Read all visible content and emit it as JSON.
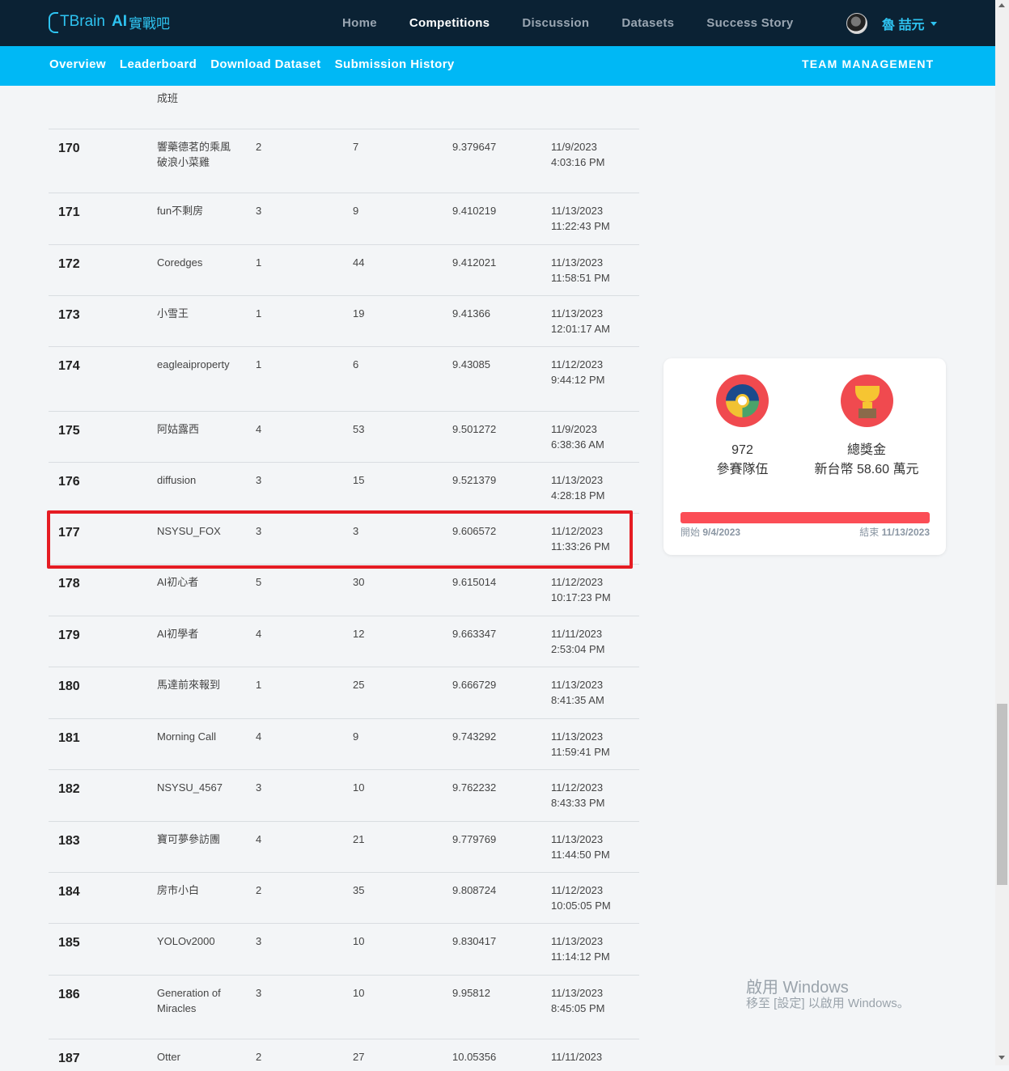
{
  "header": {
    "logo_text": "TBrain",
    "logo_ai": "AI",
    "logo_cn": "實戰吧",
    "nav": [
      "Home",
      "Competitions",
      "Discussion",
      "Datasets",
      "Success Story"
    ],
    "active_nav": "Competitions",
    "user_name": "魯 喆元"
  },
  "subnav": {
    "links": [
      "Overview",
      "Leaderboard",
      "Download Dataset",
      "Submission History"
    ],
    "team_management": "TEAM MANAGEMENT"
  },
  "leaderboard": {
    "partial_top_row": {
      "team_line": "成班"
    },
    "rows": [
      {
        "rank": "170",
        "team": "響藥德茗的乘風破浪小菜雞",
        "members": "2",
        "submissions": "7",
        "score": "9.379647",
        "time": "11/9/2023 4:03:16 PM"
      },
      {
        "rank": "171",
        "team": "fun不剩房",
        "members": "3",
        "submissions": "9",
        "score": "9.410219",
        "time": "11/13/2023 11:22:43 PM"
      },
      {
        "rank": "172",
        "team": "Coredges",
        "members": "1",
        "submissions": "44",
        "score": "9.412021",
        "time": "11/13/2023 11:58:51 PM"
      },
      {
        "rank": "173",
        "team": "小雪王",
        "members": "1",
        "submissions": "19",
        "score": "9.41366",
        "time": "11/13/2023 12:01:17 AM"
      },
      {
        "rank": "174",
        "team": "eagleaiproperty",
        "members": "1",
        "submissions": "6",
        "score": "9.43085",
        "time": "11/12/2023 9:44:12 PM"
      },
      {
        "rank": "175",
        "team": "阿姑露西",
        "members": "4",
        "submissions": "53",
        "score": "9.501272",
        "time": "11/9/2023 6:38:36 AM"
      },
      {
        "rank": "176",
        "team": "diffusion",
        "members": "3",
        "submissions": "15",
        "score": "9.521379",
        "time": "11/13/2023 4:28:18 PM"
      },
      {
        "rank": "177",
        "team": "NSYSU_FOX",
        "members": "3",
        "submissions": "3",
        "score": "9.606572",
        "time": "11/12/2023 11:33:26 PM"
      },
      {
        "rank": "178",
        "team": "AI初心者",
        "members": "5",
        "submissions": "30",
        "score": "9.615014",
        "time": "11/12/2023 10:17:23 PM"
      },
      {
        "rank": "179",
        "team": "AI初學者",
        "members": "4",
        "submissions": "12",
        "score": "9.663347",
        "time": "11/11/2023 2:53:04 PM"
      },
      {
        "rank": "180",
        "team": "馬達前來報到",
        "members": "1",
        "submissions": "25",
        "score": "9.666729",
        "time": "11/13/2023 8:41:35 AM"
      },
      {
        "rank": "181",
        "team": "Morning Call",
        "members": "4",
        "submissions": "9",
        "score": "9.743292",
        "time": "11/13/2023 11:59:41 PM"
      },
      {
        "rank": "182",
        "team": "NSYSU_4567",
        "members": "3",
        "submissions": "10",
        "score": "9.762232",
        "time": "11/12/2023 8:43:33 PM"
      },
      {
        "rank": "183",
        "team": "寶可夢參訪團",
        "members": "4",
        "submissions": "21",
        "score": "9.779769",
        "time": "11/13/2023 11:44:50 PM"
      },
      {
        "rank": "184",
        "team": "房市小白",
        "members": "2",
        "submissions": "35",
        "score": "9.808724",
        "time": "11/12/2023 10:05:05 PM"
      },
      {
        "rank": "185",
        "team": "YOLOv2000",
        "members": "3",
        "submissions": "10",
        "score": "9.830417",
        "time": "11/13/2023 11:14:12 PM"
      },
      {
        "rank": "186",
        "team": "Generation of Miracles",
        "members": "3",
        "submissions": "10",
        "score": "9.95812",
        "time": "11/13/2023 8:45:05 PM"
      },
      {
        "rank": "187",
        "team": "Otter",
        "members": "2",
        "submissions": "27",
        "score": "10.05356",
        "time": "11/11/2023"
      }
    ]
  },
  "info_card": {
    "teams_count": "972",
    "teams_label": "參賽隊伍",
    "prize_label": "總獎金",
    "prize_value": "新台幣 58.60 萬元",
    "start_label": "開始",
    "start_date": "9/4/2023",
    "end_label": "結束",
    "end_date": "11/13/2023",
    "progress": 1.0,
    "bar_color": "#fb4d56"
  },
  "watermark": {
    "line1": "啟用 Windows",
    "line2": "移至 [設定] 以啟用 Windows。"
  },
  "colors": {
    "topnav": "#0b2234",
    "subnav": "#00b8f5",
    "highlight": "#e51c23",
    "accent": "#2ec3f0"
  }
}
